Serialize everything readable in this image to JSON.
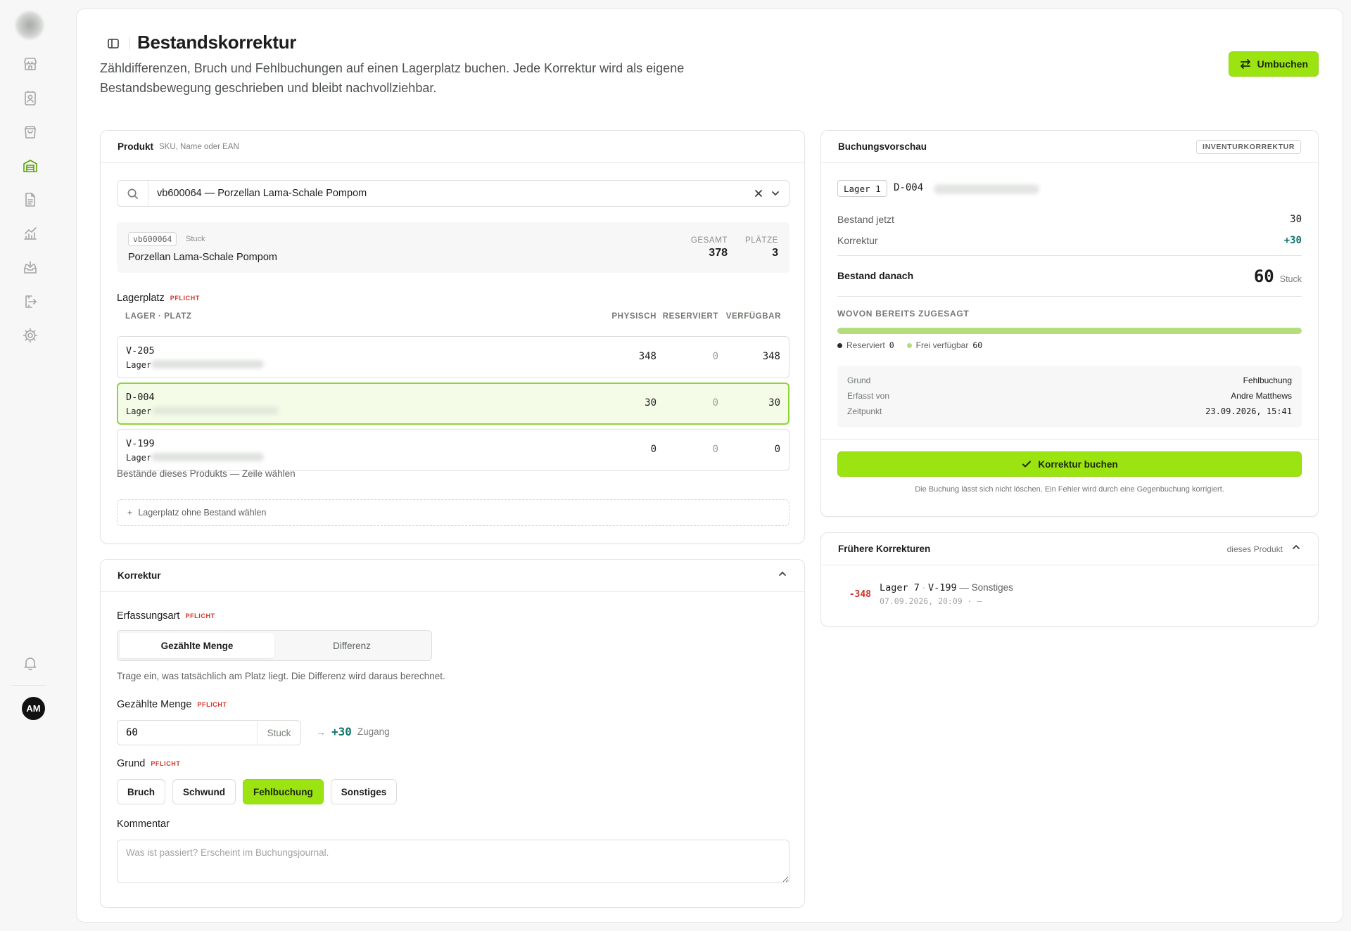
{
  "page": {
    "title": "Bestandskorrektur",
    "description": "Zähldifferenzen, Bruch und Fehlbuchungen auf einen Lagerplatz buchen. Jede Korrektur wird als eigene Bestandsbewegung geschrieben und bleibt nachvollziehbar.",
    "umbuchen_label": "Umbuchen"
  },
  "user": {
    "initials": "AM"
  },
  "sidebar": {
    "items": [
      "store-icon",
      "contacts-icon",
      "shopping-bag-icon",
      "warehouse-icon",
      "document-icon",
      "chart-icon",
      "inbox-download-icon",
      "export-icon",
      "settings-icon",
      "bell-icon"
    ],
    "active": "warehouse-icon",
    "active_color": "#5aa10a"
  },
  "produkt": {
    "title": "Produkt",
    "subtitle": "SKU, Name oder EAN",
    "search_value": "vb600064 — Porzellan Lama-Schale Pompom",
    "sku": "vb600064",
    "unit": "Stuck",
    "name": "Porzellan Lama-Schale Pompom",
    "gesamt_label": "GESAMT",
    "gesamt_value": "378",
    "plaetze_label": "PLÄTZE",
    "plaetze_value": "3"
  },
  "lagerplatz": {
    "label": "Lagerplatz",
    "pflicht": "PFLICHT",
    "col_lager": "LAGER · PLATZ",
    "col_physisch": "PHYSISCH",
    "col_reserviert": "RESERVIERT",
    "col_verfuegbar": "VERFÜGBAR",
    "rows": [
      {
        "code": "V-205",
        "lager": "Lager",
        "physisch": "348",
        "reserviert": "0",
        "verfuegbar": "348",
        "selected": false
      },
      {
        "code": "D-004",
        "lager": "Lager",
        "physisch": "30",
        "reserviert": "0",
        "verfuegbar": "30",
        "selected": true
      },
      {
        "code": "V-199",
        "lager": "Lager",
        "physisch": "0",
        "reserviert": "0",
        "verfuegbar": "0",
        "selected": false
      }
    ],
    "hint": "Bestände dieses Produkts — Zeile wählen",
    "add_label": "Lagerplatz ohne Bestand wählen"
  },
  "korrektur": {
    "title": "Korrektur",
    "erfassungsart_label": "Erfassungsart",
    "pflicht": "PFLICHT",
    "mode_counted": "Gezählte Menge",
    "mode_diff": "Differenz",
    "mode_help": "Trage ein, was tatsächlich am Platz liegt. Die Differenz wird daraus berechnet.",
    "qty_label": "Gezählte Menge",
    "qty_value": "60",
    "qty_unit": "Stuck",
    "delta_arrow": "→",
    "delta_value": "+30",
    "delta_label": "Zugang",
    "grund_label": "Grund",
    "reasons": [
      "Bruch",
      "Schwund",
      "Fehlbuchung",
      "Sonstiges"
    ],
    "active_reason": "Fehlbuchung",
    "kommentar_label": "Kommentar",
    "kommentar_placeholder": "Was ist passiert? Erscheint im Buchungsjournal."
  },
  "vorschau": {
    "title": "Buchungsvorschau",
    "badge": "INVENTURKORREKTUR",
    "lager": "Lager 1",
    "platz": "D-004",
    "bestand_jetzt_label": "Bestand jetzt",
    "bestand_jetzt": "30",
    "korrektur_label": "Korrektur",
    "korrektur_value": "+30",
    "bestand_danach_label": "Bestand danach",
    "bestand_danach": "60",
    "unit": "Stuck",
    "zugesagt_label": "WOVON BEREITS ZUGESAGT",
    "free_fraction": 1.0,
    "reserviert_label": "Reserviert",
    "reserviert_value": "0",
    "frei_label": "Frei verfügbar",
    "frei_value": "60",
    "grund_label": "Grund",
    "grund_value": "Fehlbuchung",
    "erfasst_label": "Erfasst von",
    "erfasst_value": "Andre Matthews",
    "zeitpunkt_label": "Zeitpunkt",
    "zeitpunkt_value": "23.09.2026, 15:41",
    "book_label": "Korrektur buchen",
    "note": "Die Buchung lässt sich nicht löschen. Ein Fehler wird durch eine Gegenbuchung korrigiert."
  },
  "historie": {
    "title": "Frühere Korrekturen",
    "scope": "dieses Produkt",
    "entries": [
      {
        "delta": "-348",
        "lager": "Lager 7",
        "platz": "V-199",
        "sep": "·",
        "grund": "— Sonstiges",
        "meta": "07.09.2026, 20:09 · —"
      }
    ]
  },
  "colors": {
    "accent": "#9be411",
    "positive": "#14756b",
    "negative": "#c8322c",
    "pflicht": "#d4332d"
  }
}
